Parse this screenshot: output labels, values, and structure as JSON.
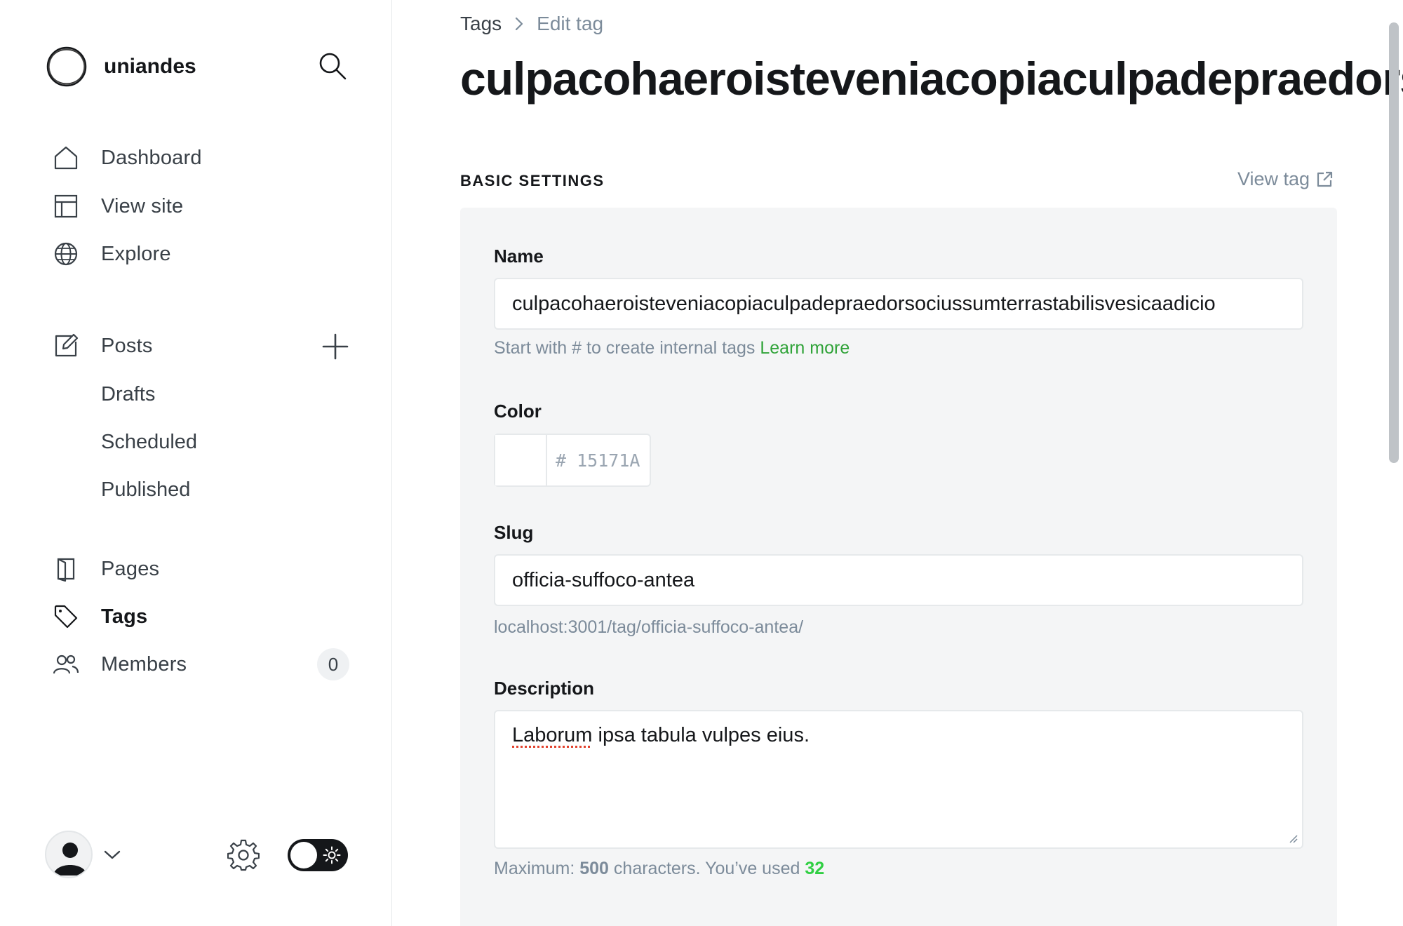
{
  "brand": {
    "name": "uniandes"
  },
  "sidebar": {
    "primary": [
      {
        "label": "Dashboard",
        "icon": "home-icon"
      },
      {
        "label": "View site",
        "icon": "layout-icon"
      },
      {
        "label": "Explore",
        "icon": "globe-icon"
      }
    ],
    "posts": {
      "label": "Posts",
      "icon": "pencil-square-icon",
      "sub": [
        "Drafts",
        "Scheduled",
        "Published"
      ]
    },
    "secondary": [
      {
        "label": "Pages",
        "icon": "page-icon"
      },
      {
        "label": "Tags",
        "icon": "tag-icon",
        "active": true
      },
      {
        "label": "Members",
        "icon": "users-icon",
        "count": "0"
      }
    ]
  },
  "breadcrumb": {
    "parent": "Tags",
    "current": "Edit tag"
  },
  "page_title": "culpacohaeroisteveniacopiaculpadepraedorsociussumterrastabilisvesicaadicio",
  "section": {
    "title": "BASIC SETTINGS",
    "view_tag": "View tag"
  },
  "form": {
    "name": {
      "label": "Name",
      "value": "culpacohaeroisteveniacopiaculpadepraedorsociussumterrastabilisvesicaadicio",
      "hint_text": "Start with # to create internal tags",
      "hint_link": "Learn more"
    },
    "color": {
      "label": "Color",
      "prefix": "#",
      "placeholder": "15171A"
    },
    "slug": {
      "label": "Slug",
      "value": "officia-suffoco-antea",
      "url": "localhost:3001/tag/officia-suffoco-antea/"
    },
    "description": {
      "label": "Description",
      "value_word1": "Laborum",
      "value_rest": " ipsa tabula vulpes eius.",
      "max_prefix": "Maximum:",
      "max_value": "500",
      "used_text": "characters. You’ve used",
      "used_value": "32"
    }
  },
  "colors": {
    "accent": "#30cf43",
    "text": "#15171a",
    "muted": "#7c8b9a",
    "card_bg": "#f4f5f6"
  }
}
